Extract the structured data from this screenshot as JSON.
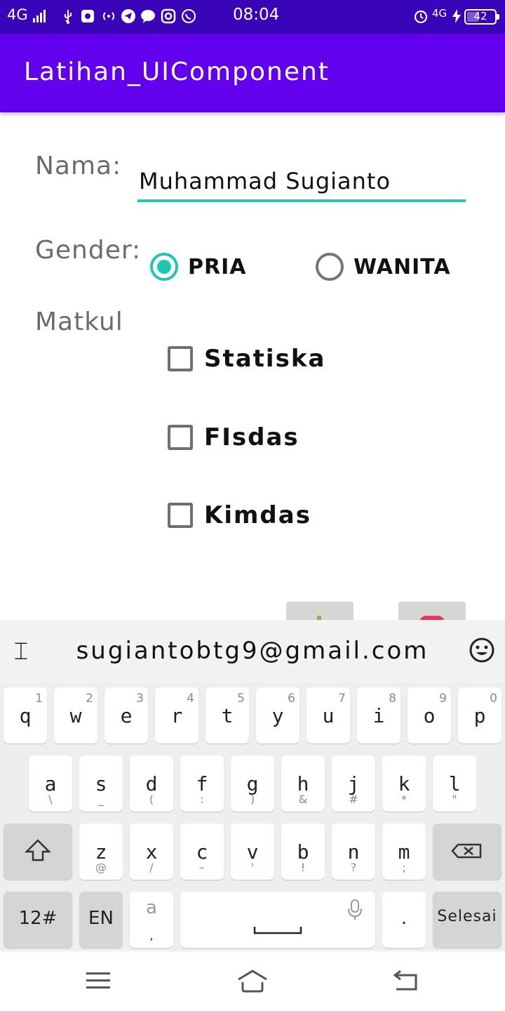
{
  "status_bar": {
    "network": "4G",
    "time": "08:04",
    "signal2": "4G",
    "battery": "42",
    "battery_level_percent": 42
  },
  "app_bar": {
    "title": "Latihan_UIComponent"
  },
  "form": {
    "nama_label": "Nama:",
    "nama_value": "Muhammad Sugianto",
    "gender_label": "Gender:",
    "gender_options": [
      {
        "label": "PRIA",
        "checked": true
      },
      {
        "label": "WANITA",
        "checked": false
      }
    ],
    "matkul_label": "Matkul",
    "matkul_options": [
      {
        "label": "Statiska",
        "checked": false
      },
      {
        "label": "FIsdas",
        "checked": false
      },
      {
        "label": "Kimdas",
        "checked": false
      }
    ]
  },
  "keyboard": {
    "suggestion": "sugiantobtg9@gmail.com",
    "row1": [
      {
        "key": "q",
        "hint": "1"
      },
      {
        "key": "w",
        "hint": "2"
      },
      {
        "key": "e",
        "hint": "3"
      },
      {
        "key": "r",
        "hint": "4"
      },
      {
        "key": "t",
        "hint": "5"
      },
      {
        "key": "y",
        "hint": "6"
      },
      {
        "key": "u",
        "hint": "7"
      },
      {
        "key": "i",
        "hint": "8"
      },
      {
        "key": "o",
        "hint": "9"
      },
      {
        "key": "p",
        "hint": "0"
      }
    ],
    "row2": [
      {
        "key": "a",
        "sub": "\\"
      },
      {
        "key": "s",
        "sub": "_"
      },
      {
        "key": "d",
        "sub": "("
      },
      {
        "key": "f",
        "sub": ":"
      },
      {
        "key": "g",
        "sub": ")"
      },
      {
        "key": "h",
        "sub": "&"
      },
      {
        "key": "j",
        "sub": "#"
      },
      {
        "key": "k",
        "sub": "*"
      },
      {
        "key": "l",
        "sub": "\""
      }
    ],
    "row3": [
      {
        "key": "z",
        "sub": "@"
      },
      {
        "key": "x",
        "sub": "/"
      },
      {
        "key": "c",
        "sub": "–"
      },
      {
        "key": "v",
        "sub": "'"
      },
      {
        "key": "b",
        "sub": "!"
      },
      {
        "key": "n",
        "sub": "?"
      },
      {
        "key": "m",
        "sub": ";"
      }
    ],
    "row4": {
      "symbols_label": "12#",
      "language_label": "EN",
      "punct_main": "a",
      "punct_sub": ",",
      "period_label": ".",
      "done_label": "Selesai"
    }
  },
  "colors": {
    "status_bar": "#3a04b8",
    "app_bar": "#6200ee",
    "accent": "#1fc4b5"
  }
}
